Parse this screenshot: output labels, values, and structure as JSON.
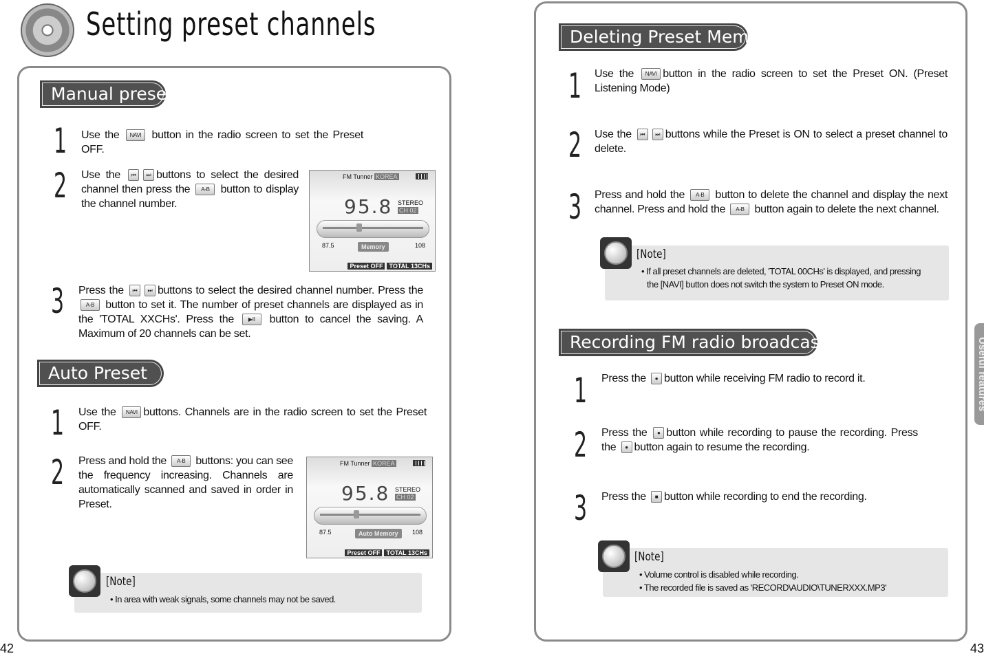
{
  "page_title": "Setting preset channels",
  "left": {
    "manual": {
      "title": "Manual preset",
      "steps": [
        {
          "n": "1",
          "parts": [
            {
              "t": "Use the "
            },
            {
              "btn": "NAVI"
            },
            {
              "t": " button in the radio screen to set the Preset OFF."
            }
          ]
        },
        {
          "n": "2",
          "parts": [
            {
              "t": "Use the "
            },
            {
              "btn": "⏮"
            },
            {
              "btn": "⏭"
            },
            {
              "t": "buttons to select the desired channel then press the "
            },
            {
              "btn": "A-B"
            },
            {
              "t": " button to display the channel number."
            }
          ]
        },
        {
          "n": "3",
          "parts": [
            {
              "t": "Press the "
            },
            {
              "btn": "⏮"
            },
            {
              "btn": "⏭"
            },
            {
              "t": "buttons to select the desired channel number. Press the "
            },
            {
              "btn": "A-B"
            },
            {
              "t": " button to set it. The number of preset channels are displayed as in the 'TOTAL XXCHs'. Press the "
            },
            {
              "btn": "▶II"
            },
            {
              "t": " button to cancel the saving. A Maximum of 20 channels can be set."
            }
          ]
        }
      ]
    },
    "auto": {
      "title": "Auto Preset",
      "steps": [
        {
          "n": "1",
          "parts": [
            {
              "t": "Use the "
            },
            {
              "btn": "NAVI"
            },
            {
              "t": "buttons. Channels are in the radio screen to set the Preset OFF."
            }
          ]
        },
        {
          "n": "2",
          "parts": [
            {
              "t": "Press and hold the "
            },
            {
              "btn": "A-B"
            },
            {
              "t": " buttons: you can see the frequency increasing. Channels are automatically scanned and saved in order in Preset."
            }
          ]
        }
      ]
    },
    "lcd1": {
      "header": "FM Tunner",
      "region": "KOREA",
      "freq": "95.8",
      "stereo": "STEREO",
      "ch": "CH 02",
      "min": "87.5",
      "max": "108",
      "mode": "Memory",
      "preset": "Preset OFF",
      "total": "TOTAL 13CHs",
      "tuning_fraction": 0.35
    },
    "lcd2": {
      "header": "FM Tunner",
      "region": "KOREA",
      "freq": "95.8",
      "stereo": "STEREO",
      "ch": "CH 02",
      "min": "87.5",
      "max": "108",
      "mode": "Auto Memory",
      "preset": "Preset OFF",
      "total": "TOTAL 13CHs",
      "tuning_fraction": 0.35
    },
    "note": {
      "heading": "[Note]",
      "lines": [
        "• In area with weak signals, some channels may not be saved."
      ]
    },
    "page_number": "42"
  },
  "right": {
    "deleting": {
      "title": "Deleting Preset Memory",
      "steps": [
        {
          "n": "1",
          "parts": [
            {
              "t": "Use the "
            },
            {
              "btn": "NAVI"
            },
            {
              "t": "button in the radio screen to set the Preset ON. (Preset Listening Mode)"
            }
          ]
        },
        {
          "n": "2",
          "parts": [
            {
              "t": "Use the "
            },
            {
              "btn": "⏮"
            },
            {
              "btn": "⏭"
            },
            {
              "t": "buttons while the Preset is ON to select a preset channel to delete."
            }
          ]
        },
        {
          "n": "3",
          "parts": [
            {
              "t": "Press and hold the "
            },
            {
              "btn": "A-B"
            },
            {
              "t": " button to delete the channel and display the next channel. Press and hold the "
            },
            {
              "btn": "A-B"
            },
            {
              "t": " button again to delete the next channel."
            }
          ]
        }
      ]
    },
    "note1": {
      "heading": "[Note]",
      "lines": [
        "• If all preset channels are deleted, 'TOTAL 00CHs' is displayed, and pressing",
        "the [NAVI] button does not switch the system to Preset ON mode."
      ]
    },
    "recording": {
      "title": "Recording  FM radio broadcasting",
      "steps": [
        {
          "n": "1",
          "parts": [
            {
              "t": "Press the "
            },
            {
              "btn": "●"
            },
            {
              "t": "button while receiving FM radio to record it."
            }
          ]
        },
        {
          "n": "2",
          "parts": [
            {
              "t": "Press the "
            },
            {
              "btn": "●"
            },
            {
              "t": "button while recording to pause the recording. Press the "
            },
            {
              "btn": "●"
            },
            {
              "t": "button again to resume the recording."
            }
          ]
        },
        {
          "n": "3",
          "parts": [
            {
              "t": "Press the "
            },
            {
              "btn": "■"
            },
            {
              "t": "button while recording to end the recording."
            }
          ]
        }
      ]
    },
    "note2": {
      "heading": "[Note]",
      "lines": [
        "• Volume control is disabled while recording.",
        "• The recorded file is saved as 'RECORD\\AUDIO\\TUNERXXX.MP3'"
      ]
    },
    "side_tab": "Useful features",
    "page_number": "43"
  }
}
